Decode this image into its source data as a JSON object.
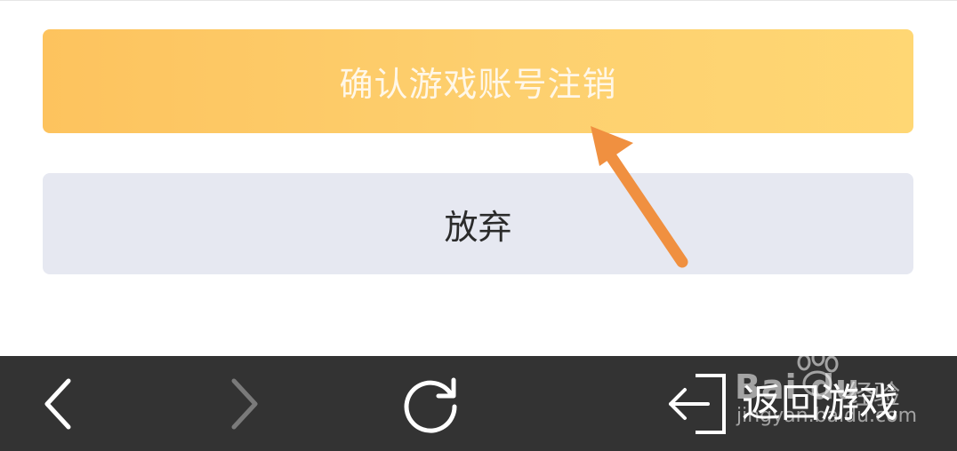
{
  "dialog": {
    "confirm_label": "确认游戏账号注销",
    "abandon_label": "放弃"
  },
  "bottom_nav": {
    "back_icon": "chevron-left-icon",
    "forward_icon": "chevron-right-icon",
    "refresh_icon": "refresh-icon",
    "return_icon": "exit-arrow-icon",
    "return_label": "返回游戏"
  },
  "watermark": {
    "logo": "Bai du",
    "sub": "经验",
    "url": "jingyan.baidu.com"
  },
  "colors": {
    "confirm_bg": "#fdc35e",
    "abandon_bg": "#e6e8f1",
    "bottom_bar_bg": "#333333",
    "annotation_arrow": "#f09040"
  }
}
